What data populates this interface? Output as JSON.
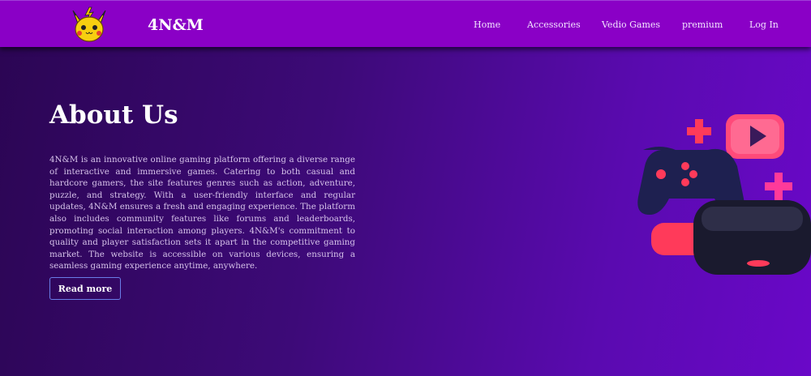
{
  "header": {
    "brand": "4N&M",
    "nav": [
      "Home",
      "Accessories",
      "Vedio Games",
      "premium",
      "Log In"
    ]
  },
  "main": {
    "title": "About Us",
    "description": "4N&M is an innovative online gaming platform offering a diverse range of interactive and immersive games. Catering to both casual and hardcore gamers, the site features genres such as action, adventure, puzzle, and strategy. With a user-friendly interface and regular updates, 4N&M ensures a fresh and engaging experience. The platform also includes community features like forums and leaderboards, promoting social interaction among players. 4N&M's commitment to quality and player satisfaction sets it apart in the competitive gaming market. The website is accessible on various devices, ensuring a seamless gaming experience anytime, anywhere.",
    "button": "Read more"
  },
  "colors": {
    "header": "#8a00c6",
    "accent": "#ff3a6a"
  }
}
